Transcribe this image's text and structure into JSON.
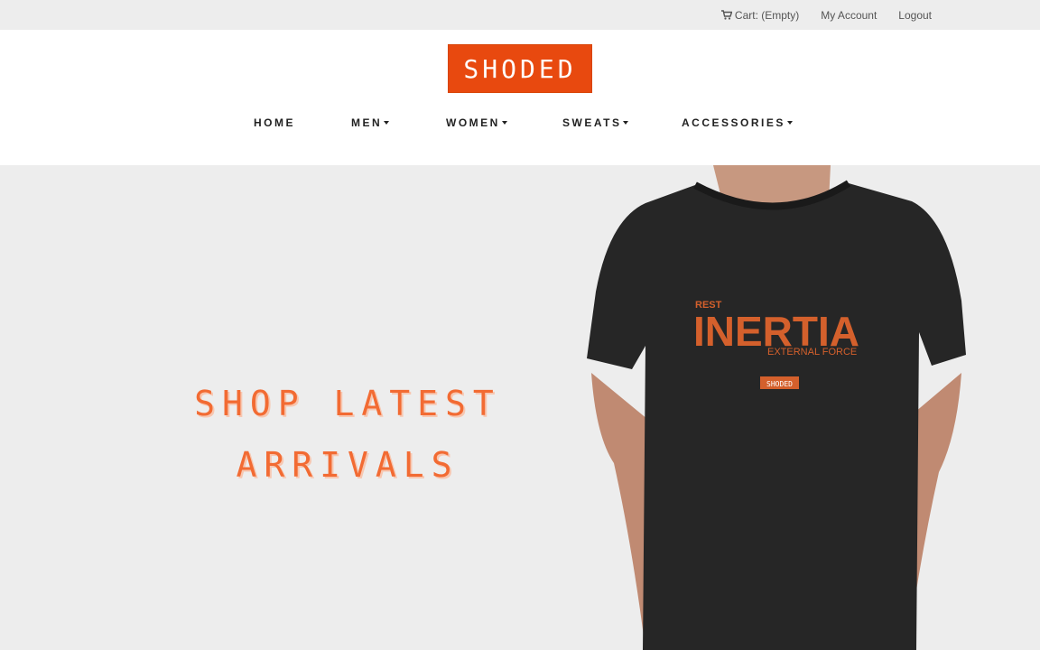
{
  "topbar": {
    "cart_label": "Cart: (Empty)",
    "account_label": "My Account",
    "logout_label": "Logout"
  },
  "brand": {
    "logo_text": "SHODED",
    "accent": "#e8490f"
  },
  "nav": {
    "home": "HOME",
    "men": "MEN",
    "women": "WOMEN",
    "sweats": "SWEATS",
    "accessories": "ACCESSORIES"
  },
  "hero": {
    "title_line1": "SHOP LATEST",
    "title_line2": "ARRIVALS",
    "shirt": {
      "small_top": "REST",
      "main": "INERTIA",
      "small_bottom": "EXTERNAL FORCE",
      "tag": "SHODED"
    }
  },
  "icons": {
    "cart": "cart-icon",
    "caret": "caret-down-icon"
  }
}
